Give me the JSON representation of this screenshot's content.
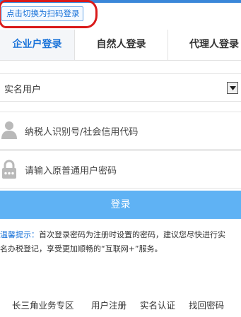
{
  "switch": {
    "label": "点击切换为扫码登录"
  },
  "tabs": [
    {
      "label": "企业户登录",
      "active": true
    },
    {
      "label": "自然人登录",
      "active": false
    },
    {
      "label": "代理人登录",
      "active": false
    }
  ],
  "form": {
    "user_type": {
      "value": "实名用户",
      "icon": "chevron-down-icon"
    },
    "tax_id": {
      "placeholder": "纳税人识别号/社会信用代码",
      "icon": "user-icon"
    },
    "password": {
      "placeholder": "请输入原普通用户密码",
      "icon": "lock-icon"
    },
    "login_label": "登录"
  },
  "tips": {
    "label": "温馨提示：",
    "line1": "首次登录密码为注册时设置的密码，建议您尽快进行实",
    "line2": "名办税登记，享受更加顺畅的“互联网+”服务。"
  },
  "footer": {
    "links": [
      "长三角业务专区",
      "用户注册",
      "实名认证",
      "找回密码"
    ]
  },
  "colors": {
    "accent": "#1a73d9",
    "button": "#5fb2f4",
    "highlight_circle": "#d91a1a"
  }
}
